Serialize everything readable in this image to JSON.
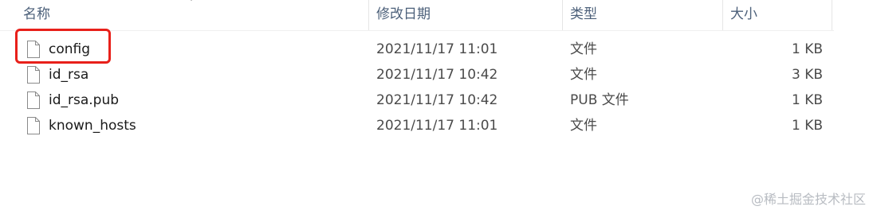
{
  "columns": {
    "name": "名称",
    "date": "修改日期",
    "type": "类型",
    "size": "大小"
  },
  "files": [
    {
      "name": "config",
      "date": "2021/11/17 11:01",
      "type": "文件",
      "size": "1 KB",
      "icon": "file-icon",
      "highlighted": true
    },
    {
      "name": "id_rsa",
      "date": "2021/11/17 10:42",
      "type": "文件",
      "size": "3 KB",
      "icon": "file-icon"
    },
    {
      "name": "id_rsa.pub",
      "date": "2021/11/17 10:42",
      "type": "PUB 文件",
      "size": "1 KB",
      "icon": "file-icon"
    },
    {
      "name": "known_hosts",
      "date": "2021/11/17 11:01",
      "type": "文件",
      "size": "1 KB",
      "icon": "file-icon"
    }
  ],
  "colors": {
    "header_text": "#4c607a",
    "highlight": "#e8201a",
    "watermark": "#b8bcc2"
  },
  "watermark": "@稀土掘金技术社区"
}
